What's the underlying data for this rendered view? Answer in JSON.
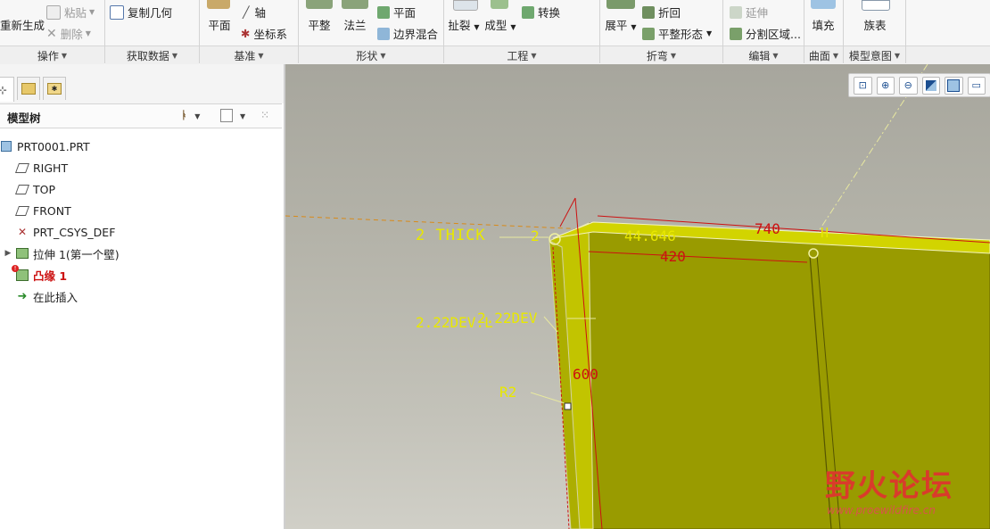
{
  "ribbon": {
    "buttons": {
      "regen": "重新生成",
      "paste": "粘贴",
      "delete": "删除",
      "copy_geometry": "复制几何",
      "plane": "平面",
      "axis": "轴",
      "csys": "坐标系",
      "flat": "平整",
      "flange": "法兰",
      "plane2": "平面",
      "boundary_blend": "边界混合",
      "rip": "扯裂",
      "form": "成型",
      "convert": "转换",
      "unbend": "展平",
      "bend_back": "折回",
      "flat_state": "平整形态",
      "extend": "延伸",
      "split_area": "分割区域...",
      "fill": "填充",
      "family_table": "族表"
    },
    "groups": [
      "操作",
      "获取数据",
      "基准",
      "形状",
      "工程",
      "折弯",
      "编辑",
      "曲面",
      "模型意图"
    ]
  },
  "panel": {
    "title": "模型树",
    "tree": [
      {
        "label": "PRT0001.PRT",
        "icon": "part-icon"
      },
      {
        "label": "RIGHT",
        "icon": "datum-plane-icon"
      },
      {
        "label": "TOP",
        "icon": "datum-plane-icon"
      },
      {
        "label": "FRONT",
        "icon": "datum-plane-icon"
      },
      {
        "label": "PRT_CSYS_DEF",
        "icon": "csys-icon"
      },
      {
        "label": "拉伸 1(第一个壁)",
        "icon": "extrude-icon"
      },
      {
        "label": "凸缘 1",
        "icon": "flange-icon",
        "status": "error"
      },
      {
        "label": "在此插入",
        "icon": "insert-arrow-icon"
      }
    ]
  },
  "viewport": {
    "annotations": {
      "thick": "2 THICK",
      "dev1": "2.22DEV.L",
      "dev2": "2.22DEV",
      "r2": "R2",
      "d740": "740",
      "d420": "420",
      "d600": "600",
      "d44": "44.646",
      "h": "H",
      "pt2": "2"
    },
    "toolbar": [
      "zoom-fit-icon",
      "zoom-in-icon",
      "zoom-out-icon",
      "repaint-icon",
      "display-style-icon",
      "saved-views-icon"
    ]
  },
  "watermark": {
    "logo": "野火论坛",
    "url": "www.proewildfire.cn"
  },
  "colors": {
    "accent": "#1c4f91",
    "part_face": "#999b00",
    "part_edge": "#c8c800",
    "dimension_yellow": "#e8e800",
    "dimension_red": "#cc1111",
    "error": "#cc1111"
  }
}
